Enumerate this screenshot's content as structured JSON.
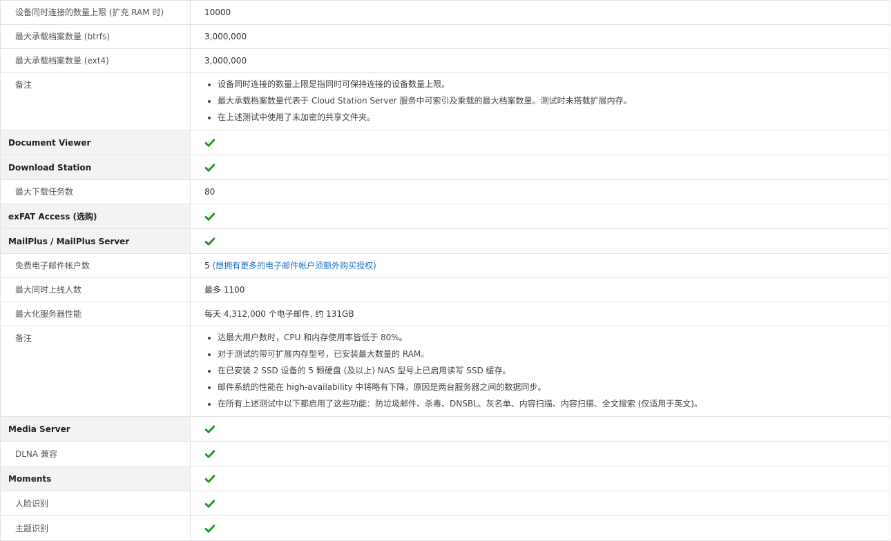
{
  "rows": {
    "r1": {
      "label": "设备同时连接的数量上限 (扩充 RAM 时)",
      "value": "10000"
    },
    "r2": {
      "label": "最大承载档案数量 (btrfs)",
      "value": "3,000,000"
    },
    "r3": {
      "label": "最大承载档案数量 (ext4)",
      "value": "3,000,000"
    },
    "r4": {
      "label": "备注",
      "notes": [
        "设备同时连接的数量上限是指同时可保持连接的设备数量上限。",
        "最大承载档案数量代表于 Cloud Station Server 服务中可索引及乘载的最大档案数量。测试时未搭载扩展内存。",
        "在上述测试中使用了未加密的共享文件夹。"
      ]
    },
    "r5": {
      "label": "Document Viewer"
    },
    "r6": {
      "label": "Download Station"
    },
    "r7": {
      "label": "最大下载任务数",
      "value": "80"
    },
    "r8": {
      "label": "exFAT Access (选购)"
    },
    "r9": {
      "label": "MailPlus / MailPlus Server"
    },
    "r10": {
      "label": "免费电子邮件帐户数",
      "value": "5",
      "link": "(想拥有更多的电子邮件帐户须额外购买授权)"
    },
    "r11": {
      "label": "最大同时上线人数",
      "value": "最多 1100"
    },
    "r12": {
      "label": "最大化服务器性能",
      "value": "每天 4,312,000 个电子邮件, 约 131GB"
    },
    "r13": {
      "label": "备注",
      "notes": [
        "达最大用户数时，CPU 和内存使用率皆低于 80%。",
        "对于测试的带可扩展内存型号，已安装最大数量的 RAM。",
        "在已安装 2 SSD 设备的 5 颗硬盘 (及以上) NAS 型号上已启用读写 SSD 缓存。",
        "邮件系统的性能在 high-availability 中将略有下降，原因是两台服务器之间的数据同步。",
        "在所有上述测试中以下都启用了这些功能：防垃圾邮件、杀毒、DNSBL、灰名单、内容扫描、内容扫描、全文搜索 (仅适用于英文)。"
      ]
    },
    "r14": {
      "label": "Media Server"
    },
    "r15": {
      "label": "DLNA 兼容"
    },
    "r16": {
      "label": "Moments"
    },
    "r17": {
      "label": "人脸识别"
    },
    "r18": {
      "label": "主题识别"
    }
  },
  "icons": {
    "check": "check-icon"
  },
  "colors": {
    "check": "#1e9c1e",
    "link": "#1a6fc8",
    "header_bg": "#f3f3f3",
    "border": "#e3e3e3"
  }
}
